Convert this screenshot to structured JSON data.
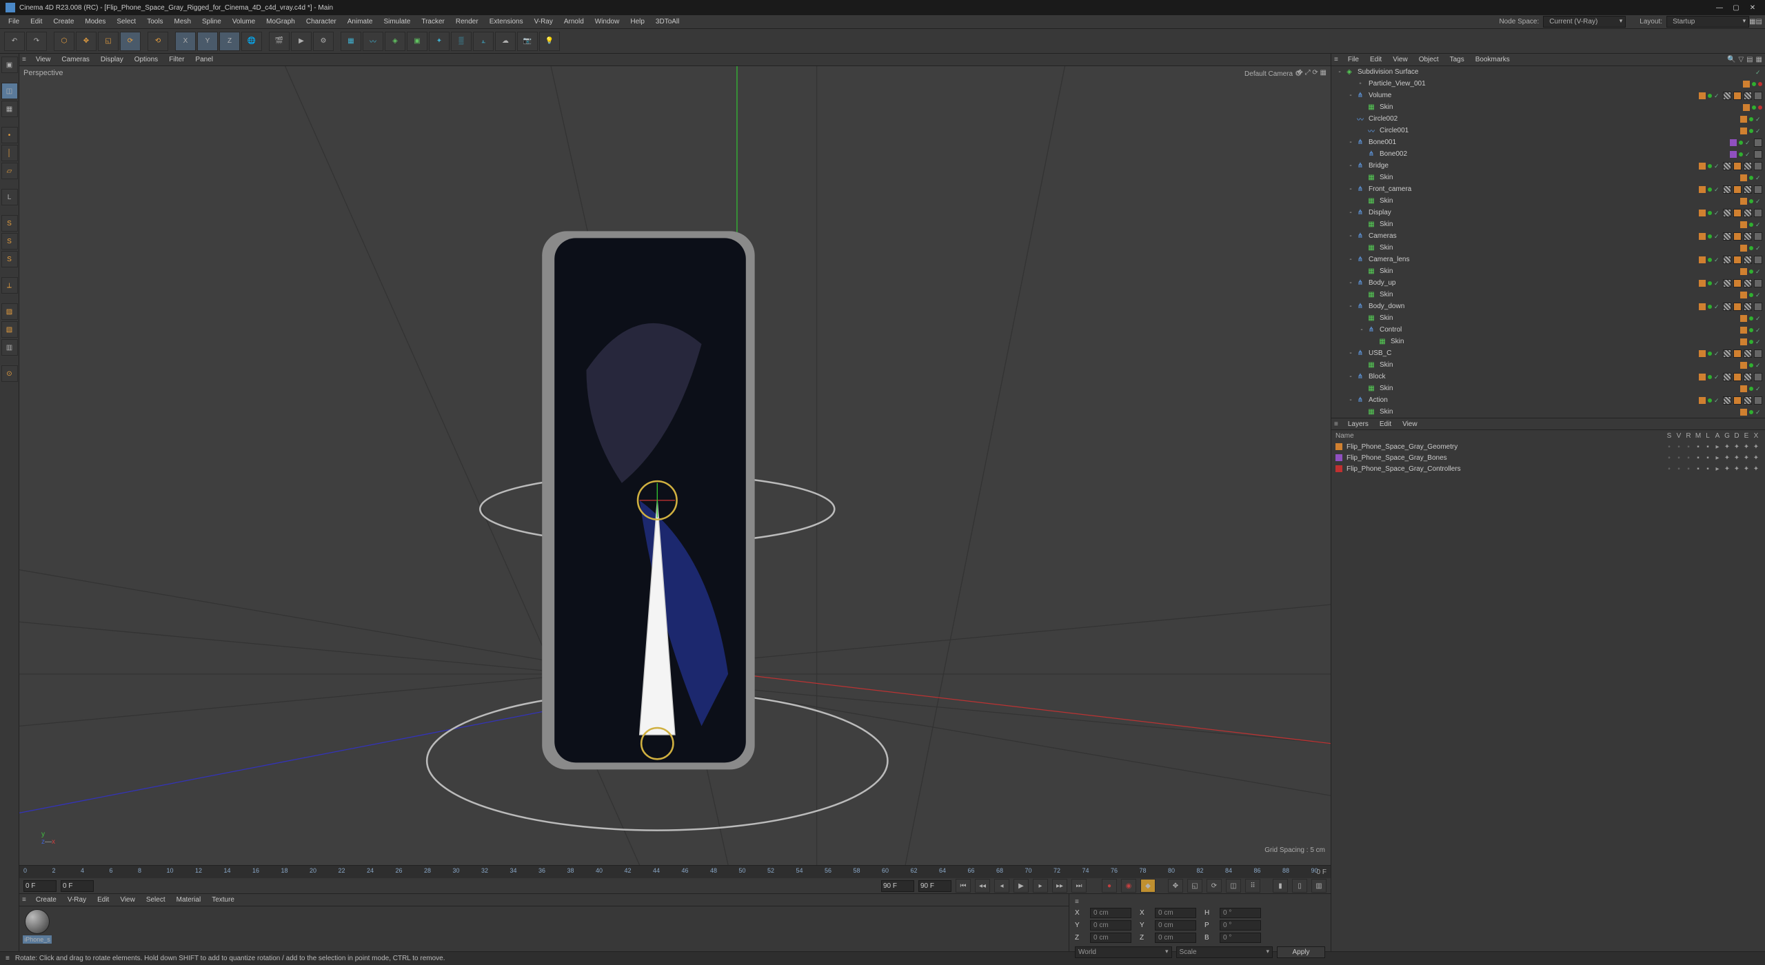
{
  "title": "Cinema 4D R23.008 (RC) - [Flip_Phone_Space_Gray_Rigged_for_Cinema_4D_c4d_vray.c4d *] - Main",
  "mainmenu": [
    "File",
    "Edit",
    "Create",
    "Modes",
    "Select",
    "Tools",
    "Mesh",
    "Spline",
    "Volume",
    "MoGraph",
    "Character",
    "Animate",
    "Simulate",
    "Tracker",
    "Render",
    "Extensions",
    "V-Ray",
    "Arnold",
    "Window",
    "Help",
    "3DToAll"
  ],
  "nodespace": {
    "label": "Node Space:",
    "value": "Current (V-Ray)"
  },
  "layout": {
    "label": "Layout:",
    "value": "Startup"
  },
  "viewportMenu": [
    "View",
    "Cameras",
    "Display",
    "Options",
    "Filter",
    "Panel"
  ],
  "viewport": {
    "label": "Perspective",
    "camera": "Default Camera",
    "grid": "Grid Spacing : 5 cm"
  },
  "timeline": {
    "start": "0 F",
    "cur": "0 F",
    "endA": "90 F",
    "endB": "90 F",
    "endLabel": "0 F",
    "ticks": [
      0,
      2,
      4,
      6,
      8,
      10,
      12,
      14,
      16,
      18,
      20,
      22,
      24,
      26,
      28,
      30,
      32,
      34,
      36,
      38,
      40,
      42,
      44,
      46,
      48,
      50,
      52,
      54,
      56,
      58,
      60,
      62,
      64,
      66,
      68,
      70,
      72,
      74,
      76,
      78,
      80,
      82,
      84,
      86,
      88,
      90
    ]
  },
  "objMenu": [
    "File",
    "Edit",
    "View",
    "Object",
    "Tags",
    "Bookmarks"
  ],
  "objects": [
    {
      "d": 0,
      "name": "Subdivision Surface",
      "icon": "subdiv",
      "tw": "-",
      "layer": "",
      "tags": [
        "chk"
      ]
    },
    {
      "d": 1,
      "name": "Particle_View_001",
      "icon": "null",
      "tw": "",
      "layer": "o",
      "tags": [
        "dotg",
        "dotr"
      ]
    },
    {
      "d": 1,
      "name": "Volume",
      "icon": "joint",
      "tw": "-",
      "layer": "o",
      "tags": [
        "dotg",
        "chk",
        "t1",
        "tv",
        "t1",
        "tc"
      ]
    },
    {
      "d": 2,
      "name": "Skin",
      "icon": "skin",
      "tw": "",
      "layer": "o",
      "tags": [
        "dotg",
        "dotr"
      ]
    },
    {
      "d": 1,
      "name": "Circle002",
      "icon": "spline",
      "tw": "",
      "layer": "o",
      "tags": [
        "dotg",
        "chk"
      ]
    },
    {
      "d": 2,
      "name": "Circle001",
      "icon": "spline",
      "tw": "",
      "layer": "o",
      "tags": [
        "dotg",
        "chk"
      ]
    },
    {
      "d": 1,
      "name": "Bone001",
      "icon": "joint",
      "tw": "-",
      "layer": "p",
      "tags": [
        "dotg",
        "chk",
        "tc"
      ]
    },
    {
      "d": 2,
      "name": "Bone002",
      "icon": "joint",
      "tw": "",
      "layer": "p",
      "tags": [
        "dotg",
        "chk",
        "tc"
      ]
    },
    {
      "d": 1,
      "name": "Bridge",
      "icon": "joint",
      "tw": "-",
      "layer": "o",
      "tags": [
        "dotg",
        "chk",
        "t1",
        "tv",
        "t1",
        "tc"
      ]
    },
    {
      "d": 2,
      "name": "Skin",
      "icon": "skin",
      "tw": "",
      "layer": "o",
      "tags": [
        "dotg",
        "chk"
      ]
    },
    {
      "d": 1,
      "name": "Front_camera",
      "icon": "joint",
      "tw": "-",
      "layer": "o",
      "tags": [
        "dotg",
        "chk",
        "t1",
        "tv",
        "t1",
        "tc"
      ]
    },
    {
      "d": 2,
      "name": "Skin",
      "icon": "skin",
      "tw": "",
      "layer": "o",
      "tags": [
        "dotg",
        "chk"
      ]
    },
    {
      "d": 1,
      "name": "Display",
      "icon": "joint",
      "tw": "-",
      "layer": "o",
      "tags": [
        "dotg",
        "chk",
        "t1",
        "tv",
        "t1",
        "tc"
      ]
    },
    {
      "d": 2,
      "name": "Skin",
      "icon": "skin",
      "tw": "",
      "layer": "o",
      "tags": [
        "dotg",
        "chk"
      ]
    },
    {
      "d": 1,
      "name": "Cameras",
      "icon": "joint",
      "tw": "-",
      "layer": "o",
      "tags": [
        "dotg",
        "chk",
        "t1",
        "tv",
        "t1",
        "tc"
      ]
    },
    {
      "d": 2,
      "name": "Skin",
      "icon": "skin",
      "tw": "",
      "layer": "o",
      "tags": [
        "dotg",
        "chk"
      ]
    },
    {
      "d": 1,
      "name": "Camera_lens",
      "icon": "joint",
      "tw": "-",
      "layer": "o",
      "tags": [
        "dotg",
        "chk",
        "t1",
        "tv",
        "t1",
        "tc"
      ]
    },
    {
      "d": 2,
      "name": "Skin",
      "icon": "skin",
      "tw": "",
      "layer": "o",
      "tags": [
        "dotg",
        "chk"
      ]
    },
    {
      "d": 1,
      "name": "Body_up",
      "icon": "joint",
      "tw": "-",
      "layer": "o",
      "tags": [
        "dotg",
        "chk",
        "t1",
        "tv",
        "t1",
        "tc"
      ]
    },
    {
      "d": 2,
      "name": "Skin",
      "icon": "skin",
      "tw": "",
      "layer": "o",
      "tags": [
        "dotg",
        "chk"
      ]
    },
    {
      "d": 1,
      "name": "Body_down",
      "icon": "joint",
      "tw": "-",
      "layer": "o",
      "tags": [
        "dotg",
        "chk",
        "t1",
        "tv",
        "t1",
        "tc"
      ]
    },
    {
      "d": 2,
      "name": "Skin",
      "icon": "skin",
      "tw": "",
      "layer": "o",
      "tags": [
        "dotg",
        "chk"
      ]
    },
    {
      "d": 2,
      "name": "Control",
      "icon": "joint",
      "tw": "-",
      "layer": "o",
      "tags": [
        "dotg",
        "chk"
      ]
    },
    {
      "d": 3,
      "name": "Skin",
      "icon": "skin",
      "tw": "",
      "layer": "o",
      "tags": [
        "dotg",
        "chk"
      ]
    },
    {
      "d": 1,
      "name": "USB_C",
      "icon": "joint",
      "tw": "-",
      "layer": "o",
      "tags": [
        "dotg",
        "chk",
        "t1",
        "tv",
        "t1",
        "tc"
      ]
    },
    {
      "d": 2,
      "name": "Skin",
      "icon": "skin",
      "tw": "",
      "layer": "o",
      "tags": [
        "dotg",
        "chk"
      ]
    },
    {
      "d": 1,
      "name": "Block",
      "icon": "joint",
      "tw": "-",
      "layer": "o",
      "tags": [
        "dotg",
        "chk",
        "t1",
        "tv",
        "t1",
        "tc"
      ]
    },
    {
      "d": 2,
      "name": "Skin",
      "icon": "skin",
      "tw": "",
      "layer": "o",
      "tags": [
        "dotg",
        "chk"
      ]
    },
    {
      "d": 1,
      "name": "Action",
      "icon": "joint",
      "tw": "-",
      "layer": "o",
      "tags": [
        "dotg",
        "chk",
        "t1",
        "tv",
        "t1",
        "tc"
      ]
    },
    {
      "d": 2,
      "name": "Skin",
      "icon": "skin",
      "tw": "",
      "layer": "o",
      "tags": [
        "dotg",
        "chk"
      ]
    }
  ],
  "layersMenu": [
    "Layers",
    "Edit",
    "View"
  ],
  "layersHead": {
    "name": "Name",
    "cols": [
      "S",
      "V",
      "R",
      "M",
      "L",
      "A",
      "G",
      "D",
      "E",
      "X"
    ]
  },
  "layers": [
    {
      "color": "#d08030",
      "name": "Flip_Phone_Space_Gray_Geometry"
    },
    {
      "color": "#9050c0",
      "name": "Flip_Phone_Space_Gray_Bones"
    },
    {
      "color": "#c03030",
      "name": "Flip_Phone_Space_Gray_Controllers"
    }
  ],
  "lowerMenu": [
    "Create",
    "V-Ray",
    "Edit",
    "View",
    "Select",
    "Material",
    "Texture"
  ],
  "material": {
    "name": "iPhone_s"
  },
  "coords": {
    "x": "0 cm",
    "y": "0 cm",
    "z": "0 cm",
    "sx": "0 cm",
    "sy": "0 cm",
    "sz": "0 cm",
    "h": "0 °",
    "p": "0 °",
    "b": "0 °",
    "selWorld": "World",
    "selScale": "Scale",
    "apply": "Apply"
  },
  "status": "Rotate: Click and drag to rotate elements. Hold down SHIFT to add to quantize rotation / add to the selection in point mode, CTRL to remove."
}
